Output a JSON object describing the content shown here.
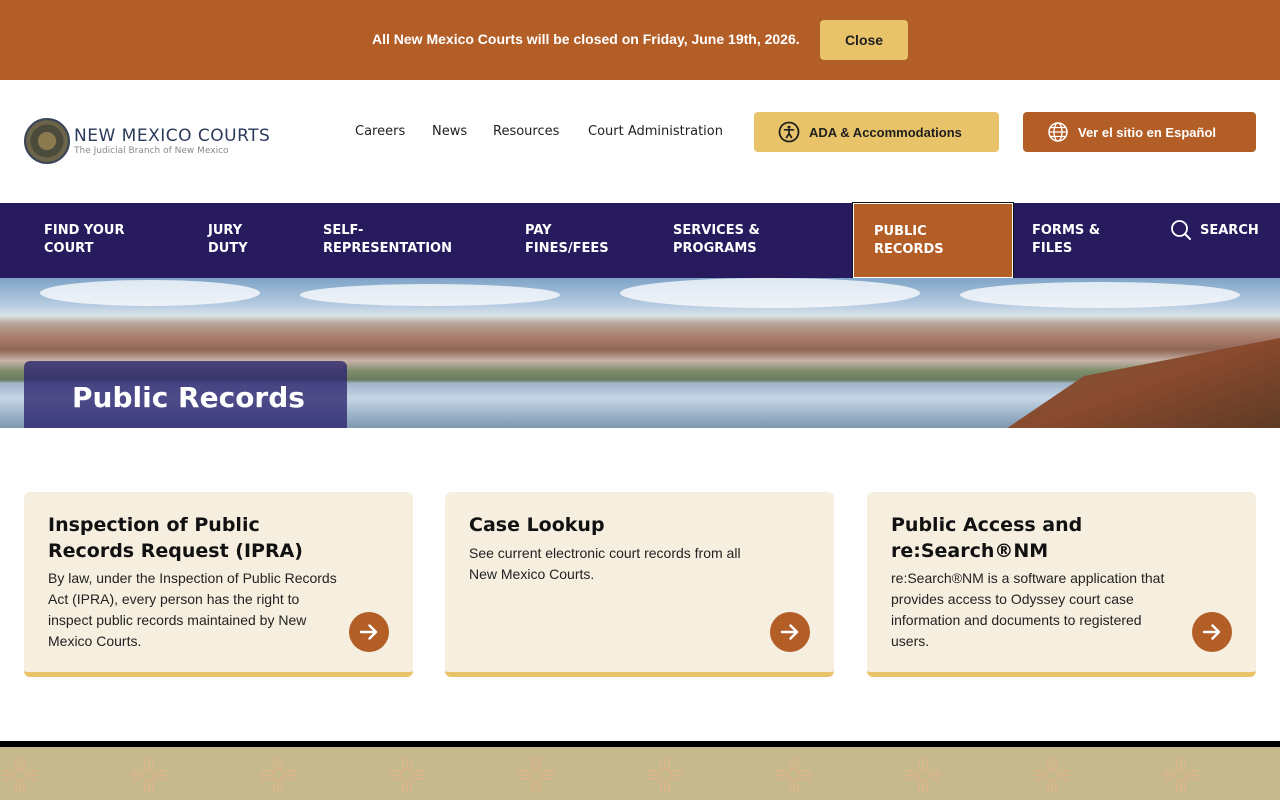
{
  "alert": {
    "message": "All New Mexico Courts will be closed on Friday, June 19th, 2026.",
    "close_label": "Close"
  },
  "header": {
    "logo_title": "NEW MEXICO COURTS",
    "logo_subtitle": "The Judicial Branch of New Mexico",
    "links": [
      "Careers",
      "News",
      "Resources",
      "Court Administration"
    ],
    "ada_label": "ADA & Accommodations",
    "spanish_label": "Ver el sitio en Español"
  },
  "nav": {
    "items": [
      {
        "line1": "FIND YOUR",
        "line2": "COURT"
      },
      {
        "line1": "JURY",
        "line2": "DUTY"
      },
      {
        "line1": "SELF-",
        "line2": "REPRESENTATION"
      },
      {
        "line1": "PAY",
        "line2": "FINES/FEES"
      },
      {
        "line1": "SERVICES &",
        "line2": "PROGRAMS"
      },
      {
        "line1": "PUBLIC",
        "line2": "RECORDS"
      },
      {
        "line1": "FORMS &",
        "line2": "FILES"
      }
    ],
    "active_index": 5,
    "search_label": "SEARCH"
  },
  "hero": {
    "title": "Public Records"
  },
  "cards": [
    {
      "title": "Inspection of Public Records Request (IPRA)",
      "body": "By law, under the Inspection of Public Records Act (IPRA), every person has the right to inspect public records maintained by New Mexico Courts."
    },
    {
      "title": "Case Lookup",
      "body": "See current electronic court records from all New Mexico Courts."
    },
    {
      "title": "Public Access and re:Search®NM",
      "body": "re:Search®NM is a software application that provides access to Odyssey court case information and documents to registered users."
    }
  ],
  "colors": {
    "brand_rust": "#b35e27",
    "brand_gold": "#e8c36a",
    "nav_purple": "#271b5e",
    "card_bg": "#f6efe0",
    "footer_tan": "#c5b98d"
  },
  "icons": {
    "ada": "accessibility-icon",
    "language": "globe-icon",
    "search": "search-icon",
    "card_link": "arrow-right-icon",
    "footer_pattern": "zia-sun-icon"
  }
}
